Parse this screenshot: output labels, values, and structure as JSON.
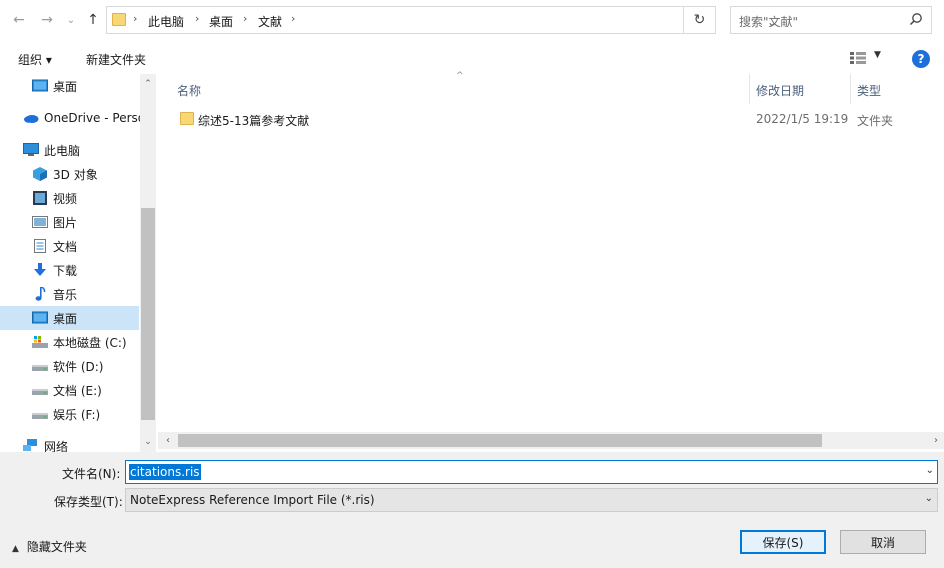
{
  "address_bar": {
    "crumbs": [
      "此电脑",
      "桌面",
      "文献"
    ],
    "search_placeholder": "搜索\"文献\""
  },
  "toolbar": {
    "organize": "组织 ▾",
    "new_folder": "新建文件夹",
    "help": "?"
  },
  "sidebar": {
    "items": [
      {
        "label": "桌面",
        "icon": "desktop-icon"
      },
      {
        "label": "OneDrive - Perso",
        "icon": "onedrive-icon"
      },
      {
        "label": "此电脑",
        "icon": "computer-icon"
      },
      {
        "label": "3D 对象",
        "icon": "3d-objects-icon"
      },
      {
        "label": "视频",
        "icon": "video-icon"
      },
      {
        "label": "图片",
        "icon": "pictures-icon"
      },
      {
        "label": "文档",
        "icon": "documents-icon"
      },
      {
        "label": "下载",
        "icon": "download-icon"
      },
      {
        "label": "音乐",
        "icon": "music-icon"
      },
      {
        "label": "桌面",
        "icon": "desktop-icon",
        "selected": true
      },
      {
        "label": "本地磁盘 (C:)",
        "icon": "drive-c-icon"
      },
      {
        "label": "软件 (D:)",
        "icon": "drive-icon"
      },
      {
        "label": "文档 (E:)",
        "icon": "drive-icon"
      },
      {
        "label": "娱乐 (F:)",
        "icon": "drive-icon"
      },
      {
        "label": "网络",
        "icon": "network-icon"
      }
    ]
  },
  "filelist": {
    "columns": [
      "名称",
      "修改日期",
      "类型"
    ],
    "rows": [
      {
        "name": "综述5-13篇参考文献",
        "modified": "2022/1/5 19:19",
        "type": "文件夹"
      }
    ]
  },
  "form": {
    "filename_label": "文件名(N):",
    "filename_value": "citations.ris",
    "filetype_label": "保存类型(T):",
    "filetype_value": "NoteExpress Reference Import File (*.ris)",
    "hide_folders": "隐藏文件夹",
    "save": "保存(S)",
    "cancel": "取消"
  },
  "colors": {
    "accent": "#0078d7",
    "selection": "#cce4f7",
    "folder": "#f8d775"
  }
}
